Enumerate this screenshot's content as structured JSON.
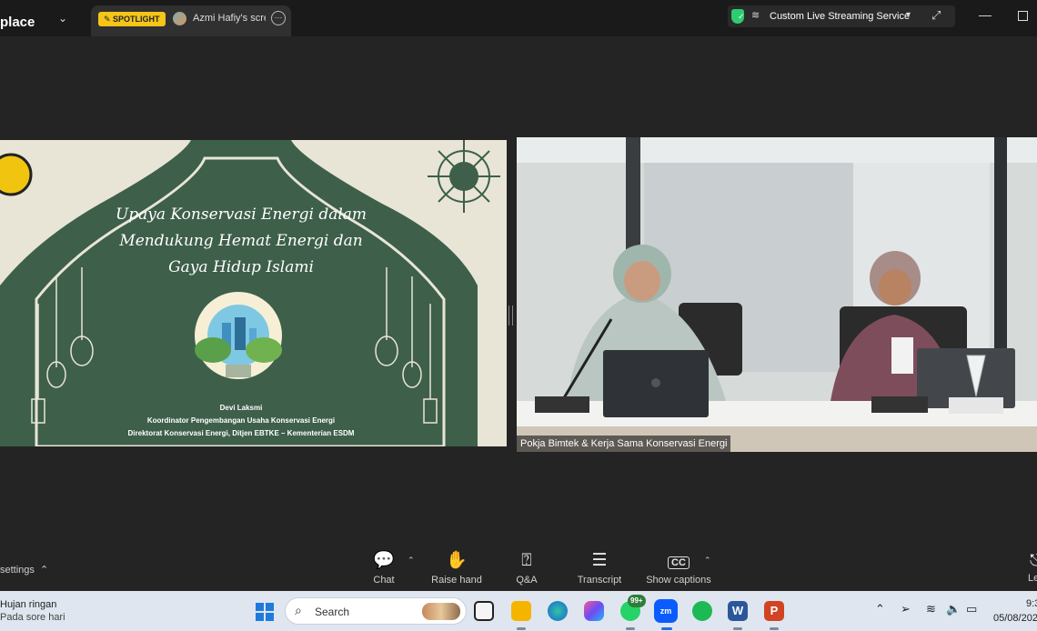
{
  "topbar": {
    "app_name": "place",
    "tab": {
      "badge": "SPOTLIGHT",
      "title": "Azmi Hafiy's scre"
    },
    "stream": {
      "label": "Custom Live Streaming Service"
    }
  },
  "slide": {
    "title_lines": [
      "Upaya Konservasi Energi dalam",
      "Mendukung Hemat Energi dan",
      "Gaya Hidup Islami"
    ],
    "presenter_name": "Devi Laksmi",
    "presenter_role": "Koordinator Pengembangan Usaha Konservasi Energi",
    "presenter_org": "Direktorat Konservasi Energi, Ditjen EBTKE – Kementerian ESDM"
  },
  "camera": {
    "participant_label": "Pokja Bimtek & Kerja Sama Konservasi Energi"
  },
  "toolbar": {
    "settings_label": "settings",
    "chat_label": "Chat",
    "raise_hand_label": "Raise hand",
    "qa_label": "Q&A",
    "transcript_label": "Transcript",
    "captions_label": "Show captions",
    "captions_icon_text": "CC",
    "leave_label": "Le"
  },
  "taskbar": {
    "weather_condition": "Hujan ringan",
    "weather_time": "Pada sore hari",
    "search_placeholder": "Search",
    "whatsapp_badge": "99+",
    "zoom_icon_text": "zm",
    "word_icon_text": "W",
    "powerpoint_icon_text": "P",
    "clock_time": "9:3",
    "clock_date": "05/08/202"
  },
  "colors": {
    "slide_green": "#3e5f4a",
    "slide_cream": "#e8e5d7",
    "spotlight_yellow": "#f5c518",
    "shield_green": "#2ecc71"
  }
}
